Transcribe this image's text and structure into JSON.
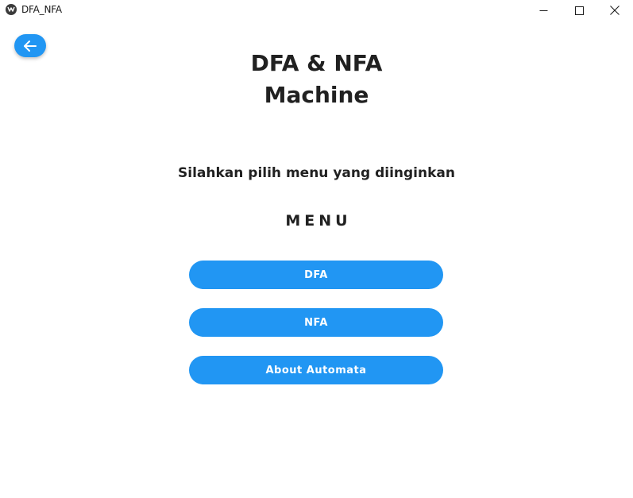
{
  "window": {
    "title": "DFA_NFA",
    "icon": "app-logo-icon",
    "controls": [
      "minimize-icon",
      "maximize-icon",
      "close-icon"
    ]
  },
  "toolbar": {
    "back_icon": "arrow-left-icon"
  },
  "main": {
    "headline_line1": "DFA & NFA",
    "headline_line2": "Machine",
    "subtitle": "Silahkan pilih menu yang diinginkan",
    "menu_heading": "MENU",
    "buttons": [
      {
        "label": "DFA"
      },
      {
        "label": "NFA"
      },
      {
        "label": "About Automata"
      }
    ]
  },
  "colors": {
    "accent": "#2196f3",
    "text": "#212121",
    "background": "#ffffff"
  }
}
